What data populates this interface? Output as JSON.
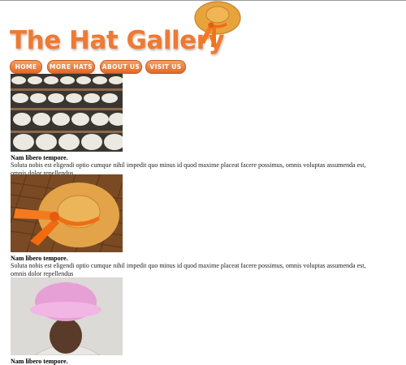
{
  "site": {
    "title": "The Hat Gallery"
  },
  "nav": {
    "items": [
      "HOME",
      "MORE HATS",
      "ABOUT US",
      "VISIT US"
    ]
  },
  "articles": [
    {
      "title": "Nam libero tempore.",
      "body": "Soluta nobis est eligendi optio cumque nihil impedit quo minus id quod maxime placeat facere possimus, omnis voluptas assumenda est, omnis dolor repellendus"
    },
    {
      "title": "Nam libero tempore.",
      "body": "Soluta nobis est eligendi optio cumque nihil impedit quo minus id quod maxime placeat facere possimus, omnis voluptas assumenda est, omnis dolor repellendus"
    },
    {
      "title": "Nam libero tempore.",
      "body": ""
    }
  ],
  "colors": {
    "brand": "#ee7a33",
    "nav_button": "#e8773a"
  },
  "icons": {
    "logo": "straw-hat-icon"
  }
}
